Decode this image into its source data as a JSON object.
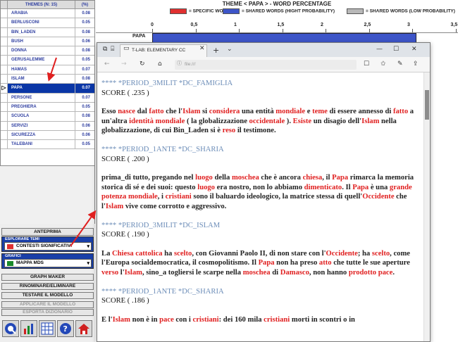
{
  "table": {
    "header_col1": "THEMES (N: 15)",
    "header_col2": "(%)",
    "rows": [
      {
        "label": "ARABIA",
        "value": "0.08"
      },
      {
        "label": "BERLUSCONI",
        "value": "0.05"
      },
      {
        "label": "BIN_LADEN",
        "value": "0.08"
      },
      {
        "label": "BUSH",
        "value": "0.06"
      },
      {
        "label": "DONNA",
        "value": "0.08"
      },
      {
        "label": "GERUSALEMME",
        "value": "0.05"
      },
      {
        "label": "HAMAS",
        "value": "0.07"
      },
      {
        "label": "ISLAM",
        "value": "0.08"
      },
      {
        "label": "PAPA",
        "value": "0.07",
        "selected": true
      },
      {
        "label": "PERSONE",
        "value": "0.07"
      },
      {
        "label": "PREGHIERA",
        "value": "0.05"
      },
      {
        "label": "SCUOLA",
        "value": "0.08"
      },
      {
        "label": "SERVIZI",
        "value": "0.06"
      },
      {
        "label": "SICUREZZA",
        "value": "0.06"
      },
      {
        "label": "TALEBANI",
        "value": "0.05"
      }
    ]
  },
  "panel": {
    "anteprima": "ANTEPRIMA",
    "esplorare_label": "ESPLORARE TEMI",
    "esplorare_value": "CONTESTI SIGNIFICATIVI",
    "grafici_label": "GRAFICI",
    "grafici_value": "MAPPA MDS",
    "graph_maker": "GRAPH MAKER",
    "rinominare": "RINOMINARE/ELIMINARE",
    "testare": "TESTARE IL MODELLO",
    "applicare": "APPLICARE IL MODELLO",
    "esporta": "ESPORTA DIZIONARIO"
  },
  "chart_data": {
    "type": "bar",
    "title": "THEME < PAPA > - WORD PERCENTAGE",
    "legend": [
      "= SPECIFIC WORDS",
      "= SHARED WORDS (HIGHT PROBABILITY)",
      "= SHARED WORDS (LOW PROBABILITY)"
    ],
    "legend_colors": [
      "#e03030",
      "#3d55c8",
      "#b8b8b8"
    ],
    "x_ticks": [
      "0",
      "0,5",
      "1",
      "1,5",
      "2",
      "2,5",
      "3",
      "3,5"
    ],
    "categories": [
      "PAPA"
    ],
    "values": [
      3.05
    ]
  },
  "browser": {
    "tab_title": "T-LAB: ELEMENTARY CC",
    "url": "file:///",
    "min": "—",
    "max": "☐",
    "close": "✕"
  },
  "content": [
    {
      "head": "**** *PERIOD_3MILIT *DC_FAMIGLIA",
      "score": "SCORE ( .235 )",
      "text": [
        [
          "",
          "Esso "
        ],
        [
          "w",
          "nasce"
        ],
        [
          "",
          " dal "
        ],
        [
          "w",
          "fatto"
        ],
        [
          "",
          " che l'"
        ],
        [
          "w",
          "Islam"
        ],
        [
          "",
          " si "
        ],
        [
          "w",
          "considera"
        ],
        [
          "",
          " una entità "
        ],
        [
          "w",
          "mondiale"
        ],
        [
          "",
          " e "
        ],
        [
          "w",
          "teme"
        ],
        [
          "",
          " di essere annesso di "
        ],
        [
          "w",
          "fatto"
        ],
        [
          "",
          " a un'altra "
        ],
        [
          "w",
          "identità mondiale"
        ],
        [
          "",
          " ( la globalizzazione "
        ],
        [
          "w",
          "occidentale"
        ],
        [
          "",
          " ). "
        ],
        [
          "w",
          "Esiste"
        ],
        [
          "",
          " un disagio dell'"
        ],
        [
          "w",
          "Islam"
        ],
        [
          "",
          " nella globalizzazione, di cui Bin_Laden si è "
        ],
        [
          "w",
          "reso"
        ],
        [
          "",
          " il testimone."
        ]
      ]
    },
    {
      "head": "**** *PERIOD_1ANTE *DC_SHARIA",
      "score": "SCORE ( .200 )",
      "text": [
        [
          "",
          "prima_di tutto, pregando nel "
        ],
        [
          "w",
          "luogo"
        ],
        [
          "",
          " della "
        ],
        [
          "w",
          "moschea"
        ],
        [
          "",
          " che è ancora "
        ],
        [
          "w",
          "chiesa"
        ],
        [
          "",
          ", il "
        ],
        [
          "w",
          "Papa"
        ],
        [
          "",
          " rimarca la memoria storica di sé e dei suoi: questo "
        ],
        [
          "w",
          "luogo"
        ],
        [
          "",
          " era nostro, non lo abbiamo "
        ],
        [
          "w",
          "dimenticato"
        ],
        [
          "",
          ". Il "
        ],
        [
          "w",
          "Papa"
        ],
        [
          "",
          " è una "
        ],
        [
          "w",
          "grande potenza mondiale"
        ],
        [
          "",
          ", i "
        ],
        [
          "w",
          "cristiani"
        ],
        [
          "",
          " sono il baluardo ideologico, la matrice stessa di quell'"
        ],
        [
          "w",
          "Occidente"
        ],
        [
          "",
          " che l'"
        ],
        [
          "w",
          "Islam"
        ],
        [
          "",
          " vive come corrotto e aggressivo."
        ]
      ]
    },
    {
      "head": "**** *PERIOD_3MILIT *DC_ISLAM",
      "score": "SCORE ( .190 )",
      "text": [
        [
          "",
          "La "
        ],
        [
          "w",
          "Chiesa cattolica"
        ],
        [
          "",
          " ha "
        ],
        [
          "w",
          "scelto"
        ],
        [
          "",
          ", con Giovanni Paolo II, di non stare con l'"
        ],
        [
          "w",
          "Occidente"
        ],
        [
          "",
          "; ha "
        ],
        [
          "w",
          "scelto"
        ],
        [
          "",
          ", come l'Europa socialdemocratica, il cosmopolitismo. Il "
        ],
        [
          "w",
          "Papa"
        ],
        [
          "",
          " non ha preso "
        ],
        [
          "w",
          "atto"
        ],
        [
          "",
          " che tutte le sue aperture "
        ],
        [
          "w",
          "verso"
        ],
        [
          "",
          " l'"
        ],
        [
          "w",
          "Islam"
        ],
        [
          "",
          ", sino_a togliersi le scarpe nella "
        ],
        [
          "w",
          "moschea"
        ],
        [
          "",
          " di "
        ],
        [
          "w",
          "Damasco"
        ],
        [
          "",
          ", non hanno "
        ],
        [
          "w",
          "prodotto pace"
        ],
        [
          "",
          "."
        ]
      ]
    },
    {
      "head": "**** *PERIOD_1ANTE *DC_SHARIA",
      "score": "SCORE ( .186 )",
      "text": [
        [
          "",
          "E l'"
        ],
        [
          "w",
          "Islam"
        ],
        [
          "",
          " non è in "
        ],
        [
          "w",
          "pace"
        ],
        [
          "",
          " con i "
        ],
        [
          "w",
          "cristiani"
        ],
        [
          "",
          ": dei 160 mila "
        ],
        [
          "w",
          "cristiani"
        ],
        [
          "",
          " morti in scontri o in"
        ]
      ]
    }
  ]
}
